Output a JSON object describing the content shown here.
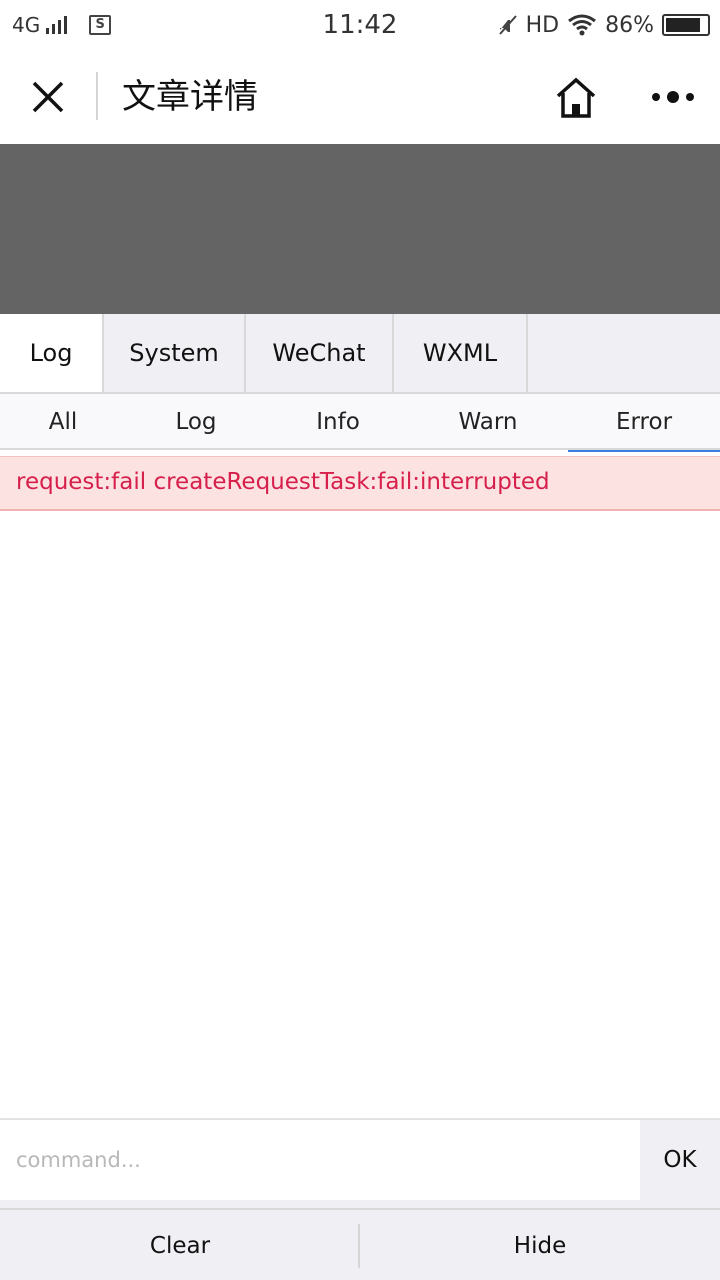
{
  "status_bar": {
    "network": "4G",
    "time": "11:42",
    "hd": "HD",
    "battery_text": "86%",
    "battery_level": 0.86,
    "icons": [
      "signal-icon",
      "sim-icon",
      "mute-icon",
      "wifi-icon",
      "battery-icon"
    ]
  },
  "nav": {
    "title": "文章详情",
    "icons": [
      "close-icon",
      "home-icon",
      "more-icon"
    ]
  },
  "primary_tabs": [
    {
      "label": "Log",
      "active": true
    },
    {
      "label": "System",
      "active": false
    },
    {
      "label": "WeChat",
      "active": false
    },
    {
      "label": "WXML",
      "active": false
    }
  ],
  "secondary_tabs": [
    {
      "label": "All",
      "active": false
    },
    {
      "label": "Log",
      "active": false
    },
    {
      "label": "Info",
      "active": false
    },
    {
      "label": "Warn",
      "active": false
    },
    {
      "label": "Error",
      "active": true
    }
  ],
  "log_entries": [
    {
      "level": "error",
      "text": "request:fail createRequestTask:fail:interrupted"
    }
  ],
  "command": {
    "placeholder": "command...",
    "value": "",
    "ok_label": "OK"
  },
  "bottom": {
    "clear_label": "Clear",
    "hide_label": "Hide"
  },
  "colors": {
    "error_text": "#d6204b",
    "error_bg": "#fde2e2",
    "active_underline": "#3a7fe0",
    "gray_block": "#646464"
  }
}
